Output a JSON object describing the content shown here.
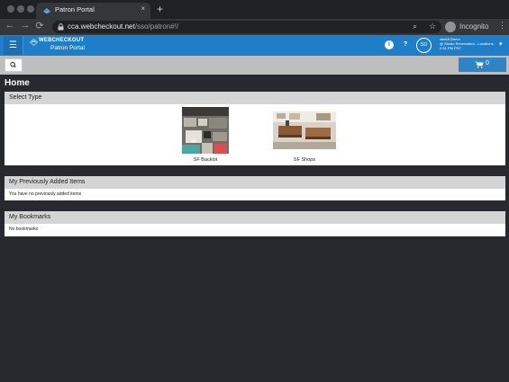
{
  "browser": {
    "tab_title": "Patron Portal",
    "tab_close": "×",
    "new_tab": "+",
    "url_host": "cca.webcheckout.net",
    "url_path": "/sso/patron#!/",
    "incognito_label": "Incognito",
    "nav": {
      "back": "←",
      "forward": "→",
      "reload": "⟳"
    },
    "icons": {
      "search": "⌕",
      "bookmark": "☆",
      "menu": "⋮"
    }
  },
  "app_header": {
    "logo_text": "WEBCHECKOUT",
    "portal_name": "Patron Portal",
    "help_icon": "?",
    "info_icon": "i",
    "avatar_initials": "SD",
    "user_name": "steelA Demo",
    "user_location": "@ Studio Reservation - Locations",
    "user_time": "2:51 PM PST",
    "brand_color": "#1e7ec8"
  },
  "actions": {
    "cart_count": "0"
  },
  "page": {
    "title": "Home"
  },
  "select_type": {
    "heading": "Select Type",
    "items": [
      {
        "label": "SF Backlot"
      },
      {
        "label": "SF Shops"
      }
    ]
  },
  "previous_items": {
    "heading": "My Previously Added Items",
    "empty_text": "You have no previously added items"
  },
  "bookmarks": {
    "heading": "My Bookmarks",
    "empty_text": "No bookmarks"
  }
}
